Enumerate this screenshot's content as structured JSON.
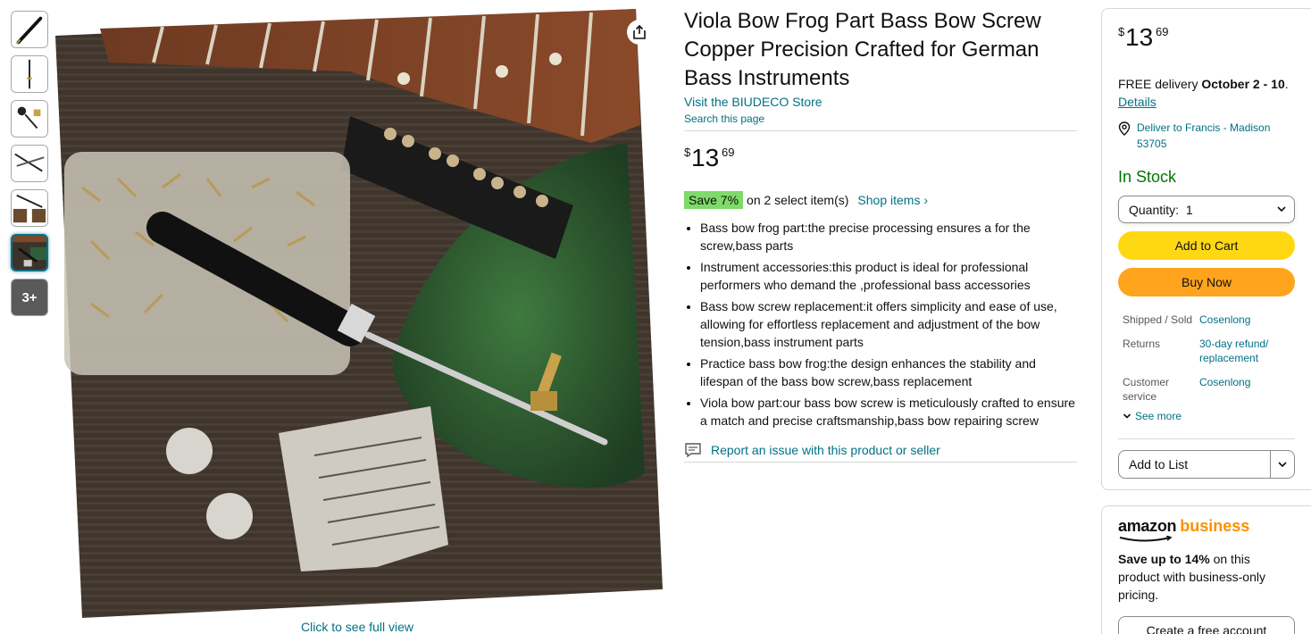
{
  "thumbnails": [
    {
      "name": "thumb-1"
    },
    {
      "name": "thumb-2"
    },
    {
      "name": "thumb-3"
    },
    {
      "name": "thumb-4"
    },
    {
      "name": "thumb-5"
    },
    {
      "name": "thumb-6",
      "active": true
    },
    {
      "name": "thumb-more",
      "label": "3+"
    }
  ],
  "image": {
    "full_view_label": "Click to see full view",
    "share_icon": "share-icon"
  },
  "product": {
    "title": "Viola Bow Frog Part Bass Bow Screw Copper Precision Crafted for German Bass Instruments",
    "store_link": "Visit the BIUDECO Store",
    "search_page": "Search this page",
    "price": {
      "symbol": "$",
      "whole": "13",
      "fraction": "69"
    },
    "save_badge": "Save 7%",
    "save_text": "on 2 select item(s)",
    "shop_items": "Shop items ›",
    "bullets": [
      "Bass bow frog part:the precise processing ensures a for the screw,bass parts",
      "Instrument accessories:this product is ideal for professional performers who demand the ,professional bass accessories",
      "Bass bow screw replacement:it offers simplicity and ease of use, allowing for effortless replacement and adjustment of the bow tension,bass instrument parts",
      "Practice bass bow frog:the design enhances the stability and lifespan of the bass bow screw,bass replacement",
      "Viola bow part:our bass bow screw is meticulously crafted to ensure a match and precise craftsmanship,bass bow repairing screw"
    ],
    "report_link": "Report an issue with this product or seller"
  },
  "buybox": {
    "price": {
      "symbol": "$",
      "whole": "13",
      "fraction": "69"
    },
    "delivery_prefix": "FREE delivery ",
    "delivery_date": "October 2 - 10",
    "delivery_suffix": ".",
    "details_link": "Details",
    "deliver_to": "Deliver to Francis - Madison 53705",
    "stock": "In Stock",
    "quantity_label": "Quantity:",
    "quantity_value": "1",
    "add_to_cart": "Add to Cart",
    "buy_now": "Buy Now",
    "shipped_sold_label": "Shipped / Sold",
    "shipped_sold_value": "Cosenlong",
    "returns_label": "Returns",
    "returns_value": "30-day refund/ replacement",
    "customer_service_label": "Customer service",
    "customer_service_value": "Cosenlong",
    "see_more": "See more",
    "add_to_list": "Add to List"
  },
  "business": {
    "logo_amazon": "amazon",
    "logo_business": "business",
    "save_bold": "Save up to 14%",
    "save_rest": " on this product with business-only pricing.",
    "create_account": "Create a free account"
  },
  "colors": {
    "link": "#007185",
    "save_badge": "#7fda69",
    "cart_button": "#ffd814",
    "buy_button": "#ffa41c",
    "in_stock": "#007600",
    "business_orange": "#ff8f00"
  }
}
